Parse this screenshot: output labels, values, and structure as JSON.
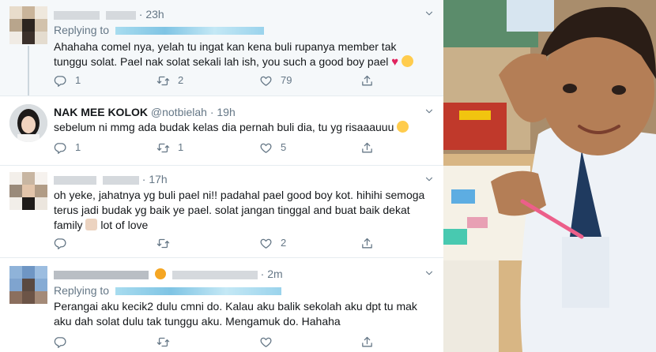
{
  "tweets": [
    {
      "time": "23h",
      "replying_label": "Replying to",
      "text": "Ahahaha comel nya, yelah tu ingat kan kena buli rupanya member tak tunggu solat. Pael nak solat sekali lah ish, you such a good boy pael",
      "replies": "1",
      "retweets": "2",
      "likes": "79"
    },
    {
      "name": "NAK MEE KOLOK",
      "handle": "@notbielah",
      "time": "19h",
      "text": "sebelum ni mmg ada budak kelas dia pernah buli dia, tu yg risaaauuu",
      "replies": "1",
      "retweets": "1",
      "likes": "5"
    },
    {
      "time": "17h",
      "text": "oh yeke, jahatnya yg buli pael ni!! padahal pael good boy kot. hihihi semoga terus jadi budak yg baik ye pael. solat jangan tinggal and buat baik dekat family",
      "text_tail": "lot of love",
      "replies": "",
      "retweets": "",
      "likes": "2"
    },
    {
      "time": "2m",
      "replying_label": "Replying to",
      "text": "Perangai aku kecik2 dulu cmni do. Kalau aku balik sekolah aku dpt tu mak aku dah solat dulu tak tunggu aku. Mengamuk do. Hahaha",
      "replies": "",
      "retweets": "",
      "likes": ""
    }
  ],
  "separator": "·",
  "icons": {
    "reply": "reply-icon",
    "retweet": "retweet-icon",
    "like": "like-icon",
    "share": "share-icon",
    "more": "chevron-down-icon"
  },
  "colors": {
    "text": "#14171a",
    "secondary": "#657786",
    "link": "#1da1f2",
    "thread_bg": "#f5f8fa",
    "divider": "#e6ecf0"
  }
}
